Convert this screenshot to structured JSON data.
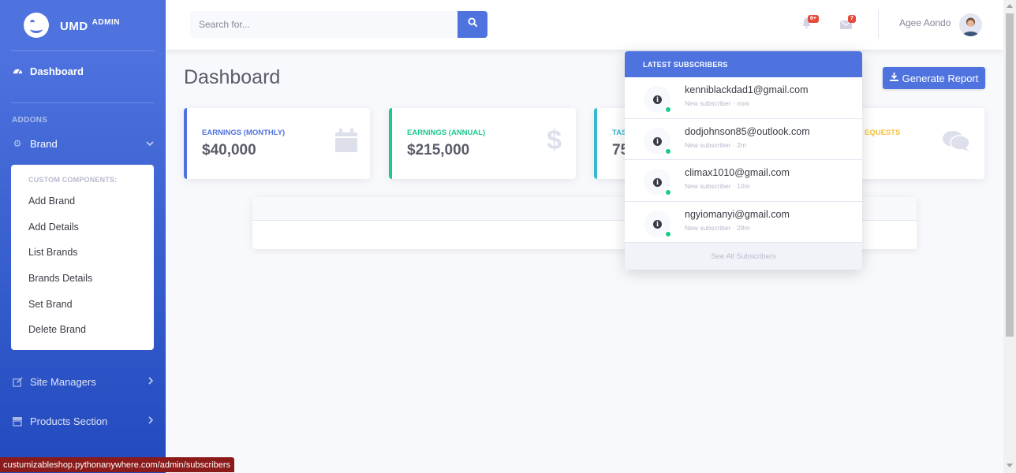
{
  "brand": {
    "name": "UMD",
    "sup": "ADMIN"
  },
  "sidebar": {
    "dashboard": "Dashboard",
    "section_heading": "ADDONS",
    "brand_item": "Brand",
    "collapse": {
      "header": "CUSTOM COMPONENTS:",
      "items": [
        "Add Brand",
        "Add Details",
        "List Brands",
        "Brands Details",
        "Set Brand",
        "Delete Brand"
      ]
    },
    "site_managers": "Site Managers",
    "products_section": "Products Section"
  },
  "topbar": {
    "search_placeholder": "Search for...",
    "alerts_badge": "6+",
    "messages_badge": "7",
    "user_name": "Agee Aondo"
  },
  "main": {
    "title": "Dashboard",
    "report_button": "Generate Report",
    "cards": [
      {
        "label": "EARNINGS (MONTHLY)",
        "value": "$40,000",
        "color": "#4e73df",
        "icon": "calendar-icon"
      },
      {
        "label": "EARNINGS (ANNUAL)",
        "value": "$215,000",
        "color": "#1cc88a",
        "icon": "dollar-icon"
      },
      {
        "label": "TAS",
        "value": "75",
        "color": "#36b9cc",
        "icon": "clipboard-icon"
      },
      {
        "label": "EQUESTS",
        "value": "",
        "color": "#f6c23e",
        "icon": "comments-icon"
      }
    ]
  },
  "subscribers_dropdown": {
    "header": "LATEST SUBSCRIBERS",
    "items": [
      {
        "email": "kenniblackdad1@gmail.com",
        "sub": "New subscriber · now"
      },
      {
        "email": "dodjohnson85@outlook.com",
        "sub": "New subscriber · 2m"
      },
      {
        "email": "climax1010@gmail.com",
        "sub": "New subscriber · 10m"
      },
      {
        "email": "ngyiomanyi@gmail.com",
        "sub": "New subscriber · 28m"
      }
    ],
    "footer": "See All Subscribers"
  },
  "status_url": "custumizableshop.pythonanywhere.com/admin/subscribers",
  "colors": {
    "primary": "#4e73df",
    "success": "#1cc88a",
    "info": "#36b9cc",
    "warning": "#f6c23e",
    "danger": "#e74a3b"
  }
}
